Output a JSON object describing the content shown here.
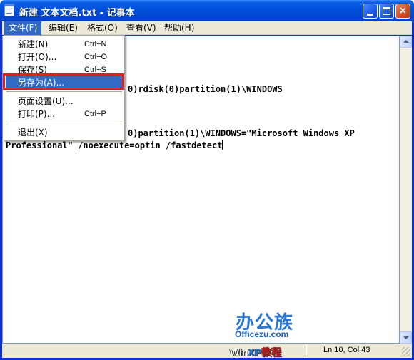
{
  "window": {
    "title": "新建 文本文档.txt - 记事本"
  },
  "title_buttons": {
    "minimize_icon": "minimize-icon",
    "maximize_icon": "maximize-icon",
    "close_label": "×"
  },
  "menubar": {
    "items": [
      {
        "label": "文件(F)"
      },
      {
        "label": "编辑(E)"
      },
      {
        "label": "格式(O)"
      },
      {
        "label": "查看(V)"
      },
      {
        "label": "帮助(H)"
      }
    ]
  },
  "file_menu": {
    "items": [
      {
        "label": "新建(N)",
        "shortcut": "Ctrl+N"
      },
      {
        "label": "打开(O)...",
        "shortcut": "Ctrl+O"
      },
      {
        "label": "保存(S)",
        "shortcut": "Ctrl+S"
      },
      {
        "label": "另存为(A)...",
        "shortcut": ""
      },
      {
        "label": "页面设置(U)...",
        "shortcut": ""
      },
      {
        "label": "打印(P)...",
        "shortcut": "Ctrl+P"
      },
      {
        "label": "退出(X)",
        "shortcut": ""
      }
    ],
    "selected_item": "另存为(A)..."
  },
  "editor": {
    "lines": [
      "0)rdisk(0)partition(1)\\WINDOWS",
      "0)partition(1)\\WINDOWS=\"Microsoft Windows XP",
      "Professional\" /noexecute=optin /fastdetect"
    ]
  },
  "statusbar": {
    "position": "Ln 10, Col 43"
  },
  "watermark": {
    "main": "办公族",
    "site": "Officezu.com",
    "brand_win": "Win",
    "brand_xp": "XP",
    "brand_jc": "教程"
  },
  "colors": {
    "titlebar": "#0050dc",
    "menu_highlight": "#316ac5",
    "annotation_box": "#e02020"
  }
}
